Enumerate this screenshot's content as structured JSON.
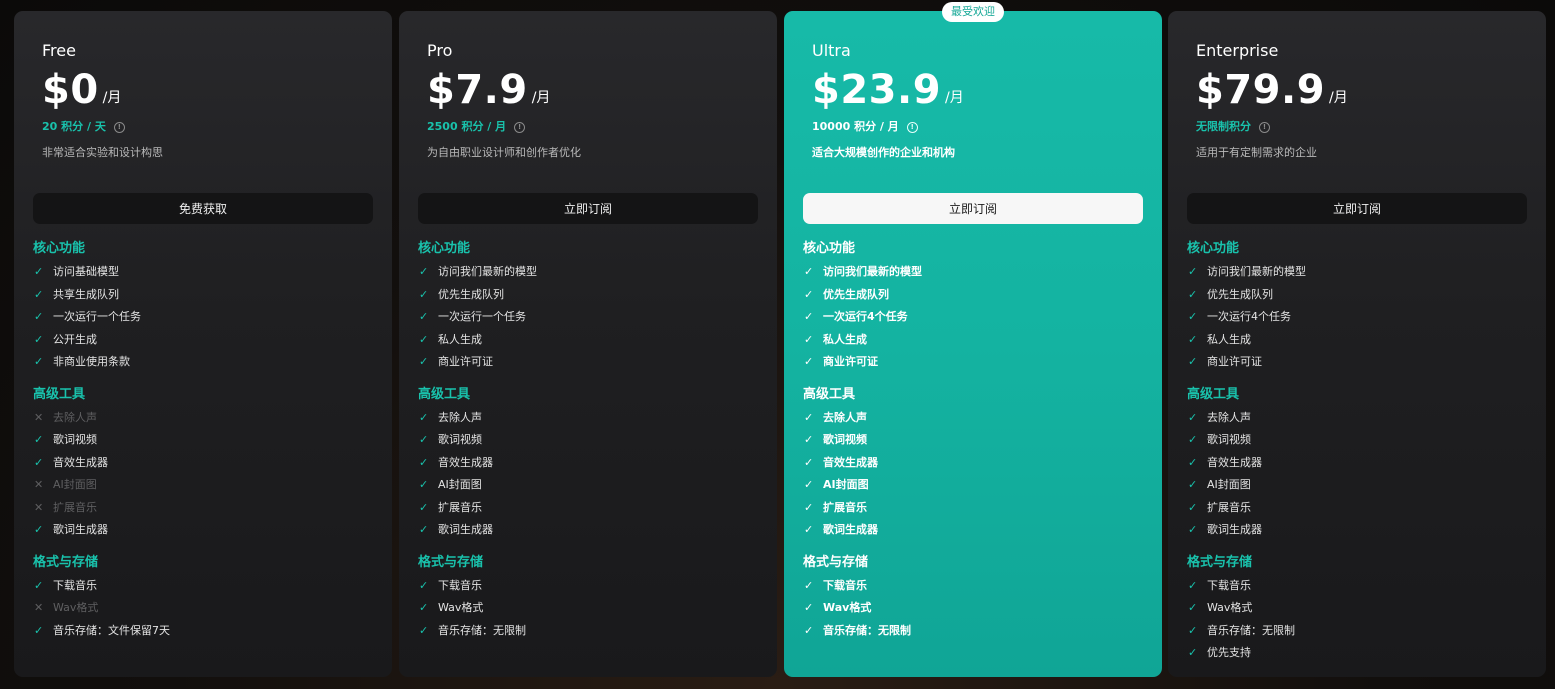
{
  "badge": "最受欢迎",
  "glyphs": {
    "check": "✓",
    "cross": "✕",
    "info": "!"
  },
  "plans": [
    {
      "name": "Free",
      "price": "$0",
      "per": "/月",
      "credits": "20 积分 / 天",
      "desc": "非常适合实验和设计构思",
      "cta": "免费获取",
      "sections": [
        {
          "title": "核心功能",
          "items": [
            {
              "label": "访问基础模型",
              "enabled": true
            },
            {
              "label": "共享生成队列",
              "enabled": true
            },
            {
              "label": "一次运行一个任务",
              "enabled": true
            },
            {
              "label": "公开生成",
              "enabled": true
            },
            {
              "label": "非商业使用条款",
              "enabled": true
            }
          ]
        },
        {
          "title": "高级工具",
          "items": [
            {
              "label": "去除人声",
              "enabled": false
            },
            {
              "label": "歌词视频",
              "enabled": true
            },
            {
              "label": "音效生成器",
              "enabled": true
            },
            {
              "label": "AI封面图",
              "enabled": false
            },
            {
              "label": "扩展音乐",
              "enabled": false
            },
            {
              "label": "歌词生成器",
              "enabled": true
            }
          ]
        },
        {
          "title": "格式与存储",
          "items": [
            {
              "label": "下载音乐",
              "enabled": true
            },
            {
              "label": "Wav格式",
              "enabled": false
            },
            {
              "label": "音乐存储：文件保留7天",
              "enabled": true
            }
          ]
        }
      ]
    },
    {
      "name": "Pro",
      "price": "$7.9",
      "per": "/月",
      "credits": "2500 积分 / 月",
      "desc": "为自由职业设计师和创作者优化",
      "cta": "立即订阅",
      "sections": [
        {
          "title": "核心功能",
          "items": [
            {
              "label": "访问我们最新的模型",
              "enabled": true
            },
            {
              "label": "优先生成队列",
              "enabled": true
            },
            {
              "label": "一次运行一个任务",
              "enabled": true
            },
            {
              "label": "私人生成",
              "enabled": true
            },
            {
              "label": "商业许可证",
              "enabled": true
            }
          ]
        },
        {
          "title": "高级工具",
          "items": [
            {
              "label": "去除人声",
              "enabled": true
            },
            {
              "label": "歌词视频",
              "enabled": true
            },
            {
              "label": "音效生成器",
              "enabled": true
            },
            {
              "label": "AI封面图",
              "enabled": true
            },
            {
              "label": "扩展音乐",
              "enabled": true
            },
            {
              "label": "歌词生成器",
              "enabled": true
            }
          ]
        },
        {
          "title": "格式与存储",
          "items": [
            {
              "label": "下载音乐",
              "enabled": true
            },
            {
              "label": "Wav格式",
              "enabled": true
            },
            {
              "label": "音乐存储：无限制",
              "enabled": true
            }
          ]
        }
      ]
    },
    {
      "name": "Ultra",
      "price": "$23.9",
      "per": "/月",
      "credits": "10000 积分 / 月",
      "desc": "适合大规模创作的企业和机构",
      "cta": "立即订阅",
      "sections": [
        {
          "title": "核心功能",
          "items": [
            {
              "label": "访问我们最新的模型",
              "enabled": true
            },
            {
              "label": "优先生成队列",
              "enabled": true
            },
            {
              "label": "一次运行4个任务",
              "enabled": true
            },
            {
              "label": "私人生成",
              "enabled": true
            },
            {
              "label": "商业许可证",
              "enabled": true
            }
          ]
        },
        {
          "title": "高级工具",
          "items": [
            {
              "label": "去除人声",
              "enabled": true
            },
            {
              "label": "歌词视频",
              "enabled": true
            },
            {
              "label": "音效生成器",
              "enabled": true
            },
            {
              "label": "AI封面图",
              "enabled": true
            },
            {
              "label": "扩展音乐",
              "enabled": true
            },
            {
              "label": "歌词生成器",
              "enabled": true
            }
          ]
        },
        {
          "title": "格式与存储",
          "items": [
            {
              "label": "下载音乐",
              "enabled": true
            },
            {
              "label": "Wav格式",
              "enabled": true
            },
            {
              "label": "音乐存储：无限制",
              "enabled": true
            }
          ]
        }
      ]
    },
    {
      "name": "Enterprise",
      "price": "$79.9",
      "per": "/月",
      "credits": "无限制积分",
      "desc": "适用于有定制需求的企业",
      "cta": "立即订阅",
      "sections": [
        {
          "title": "核心功能",
          "items": [
            {
              "label": "访问我们最新的模型",
              "enabled": true
            },
            {
              "label": "优先生成队列",
              "enabled": true
            },
            {
              "label": "一次运行4个任务",
              "enabled": true
            },
            {
              "label": "私人生成",
              "enabled": true
            },
            {
              "label": "商业许可证",
              "enabled": true
            }
          ]
        },
        {
          "title": "高级工具",
          "items": [
            {
              "label": "去除人声",
              "enabled": true
            },
            {
              "label": "歌词视频",
              "enabled": true
            },
            {
              "label": "音效生成器",
              "enabled": true
            },
            {
              "label": "AI封面图",
              "enabled": true
            },
            {
              "label": "扩展音乐",
              "enabled": true
            },
            {
              "label": "歌词生成器",
              "enabled": true
            }
          ]
        },
        {
          "title": "格式与存储",
          "items": [
            {
              "label": "下载音乐",
              "enabled": true
            },
            {
              "label": "Wav格式",
              "enabled": true
            },
            {
              "label": "音乐存储：无限制",
              "enabled": true
            },
            {
              "label": "优先支持",
              "enabled": true
            }
          ]
        }
      ]
    }
  ]
}
